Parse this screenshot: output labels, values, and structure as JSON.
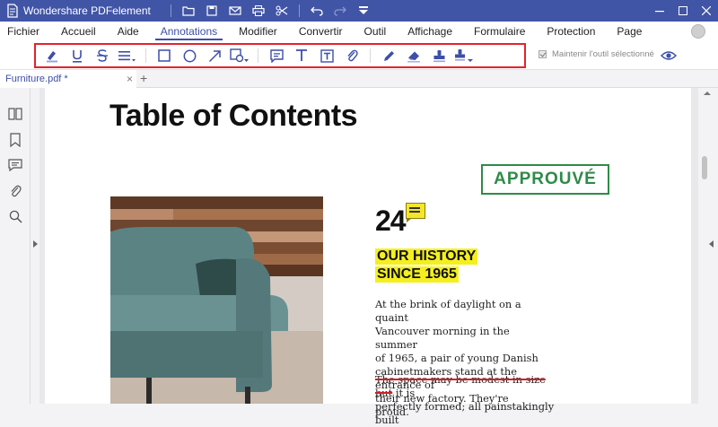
{
  "app": {
    "title": "Wondershare PDFelement",
    "accent": "#4155a6"
  },
  "titlebar_icons": [
    "folder-icon",
    "save-icon",
    "mail-icon",
    "print-icon",
    "scissors-icon",
    "undo-icon",
    "redo-icon",
    "dropdown-icon"
  ],
  "menu": {
    "items": [
      "Fichier",
      "Accueil",
      "Aide",
      "Annotations",
      "Modifier",
      "Convertir",
      "Outil",
      "Affichage",
      "Formulaire",
      "Protection",
      "Page"
    ],
    "active": "Annotations"
  },
  "annotation_tools": [
    "highlight-icon",
    "underline-icon",
    "strikethrough-icon",
    "text-lines-icon",
    "rectangle-icon",
    "ellipse-icon",
    "arrow-icon",
    "shape-dropdown-icon",
    "sticky-note-icon",
    "text-icon",
    "text-box-icon",
    "attachment-icon",
    "pencil-icon",
    "eraser-icon",
    "stamp-icon",
    "signature-stamp-icon"
  ],
  "keep_tool": {
    "label": "Maintenir l'outil sélectionné",
    "checked": true
  },
  "tab": {
    "label": "Furniture.pdf *",
    "close": "×",
    "add": "+"
  },
  "sidebar_icons": [
    "thumbnails-icon",
    "bookmark-icon",
    "comment-icon",
    "attachment-icon",
    "search-icon"
  ],
  "document": {
    "title": "Table of Contents",
    "stamp": "APPROUVÉ",
    "stamp_color": "#2e8b47",
    "page_number": "24",
    "heading_line1": "OUR HISTORY",
    "heading_line2": "SINCE 1965",
    "highlight_color": "#f5ef1f",
    "paragraph": [
      "At the brink of daylight on a quaint",
      "Vancouver morning in the summer",
      "of 1965, a pair of young Danish",
      "cabinetmakers stand at the entrance of",
      "their new factory. They're proud."
    ],
    "strike_text": "The space may be modest in size but",
    "after_strike": " it is",
    "para2_line2": "perfectly formed; all painstakingly built"
  }
}
